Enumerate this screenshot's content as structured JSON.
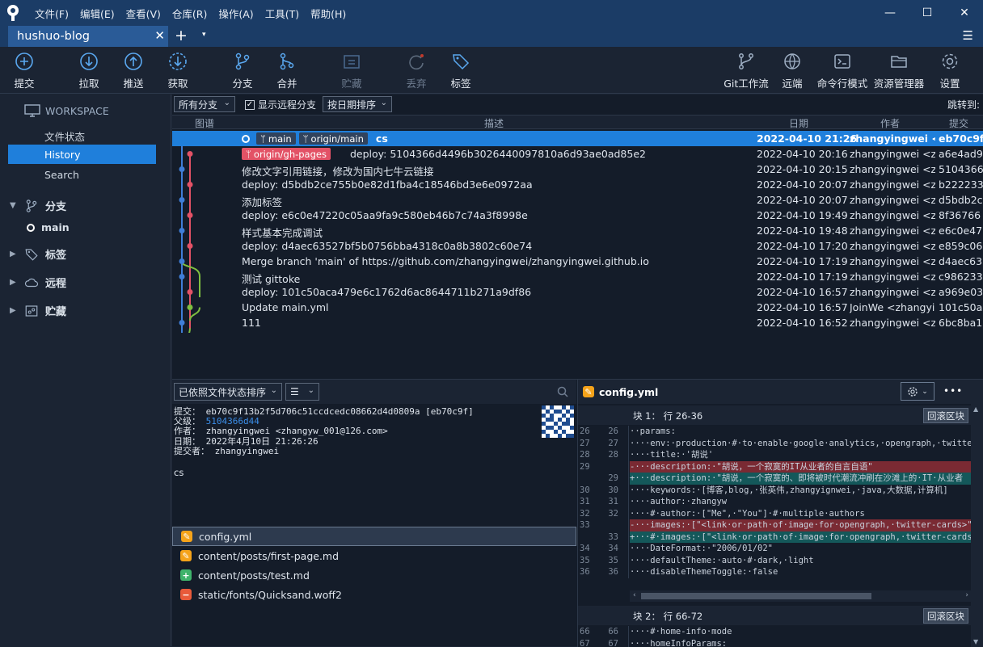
{
  "menu": {
    "items": [
      "文件(F)",
      "编辑(E)",
      "查看(V)",
      "仓库(R)",
      "操作(A)",
      "工具(T)",
      "帮助(H)"
    ]
  },
  "window": {
    "min": "—",
    "max": "☐",
    "close": "✕"
  },
  "tab": {
    "title": "hushuo-blog",
    "close": "✕",
    "add": "+",
    "dropdown": "▾",
    "menu": "☰"
  },
  "toolbar": {
    "commit": "提交",
    "pull": "拉取",
    "push": "推送",
    "fetch": "获取",
    "branch": "分支",
    "merge": "合并",
    "stash": "贮藏",
    "discard": "丢弃",
    "tag": "标签",
    "gitflow": "Git工作流",
    "remote": "远端",
    "terminal": "命令行模式",
    "explorer": "资源管理器",
    "settings": "设置"
  },
  "sidebar": {
    "workspace": "WORKSPACE",
    "file_status": "文件状态",
    "history": "History",
    "search": "Search",
    "branches": "分支",
    "main_branch": "main",
    "tags": "标签",
    "remotes": "远程",
    "stashes": "贮藏"
  },
  "graph": {
    "filter_branches": "所有分支",
    "show_remote": "显示远程分支",
    "sort": "按日期排序",
    "jump": "跳转到:",
    "headers": {
      "graph": "图谱",
      "desc": "描述",
      "date": "日期",
      "author": "作者",
      "commit": "提交"
    },
    "rows": [
      {
        "tags": [
          "main",
          "origin/main"
        ],
        "desc": "cs",
        "date": "2022-04-10 21:26",
        "author": "zhangyingwei <",
        "hash": "eb70c9f"
      },
      {
        "tags": [
          "origin/gh-pages"
        ],
        "desc": "deploy: 5104366d4496b3026440097810a6d93ae0ad85e2",
        "date": "2022-04-10 20:16",
        "author": "zhangyingwei <z",
        "hash": "a6e4ad9"
      },
      {
        "desc": "修改文字引用链接，修改为国内七牛云链接",
        "date": "2022-04-10 20:15",
        "author": "zhangyingwei <z",
        "hash": "5104366"
      },
      {
        "desc": "deploy: d5bdb2ce755b0e82d1fba4c18546bd3e6e0972aa",
        "date": "2022-04-10 20:07",
        "author": "zhangyingwei <z",
        "hash": "b222233"
      },
      {
        "desc": "添加标签",
        "date": "2022-04-10 20:07",
        "author": "zhangyingwei <z",
        "hash": "d5bdb2c"
      },
      {
        "desc": "deploy: e6c0e47220c05aa9fa9c580eb46b7c74a3f8998e",
        "date": "2022-04-10 19:49",
        "author": "zhangyingwei <z",
        "hash": "8f36766"
      },
      {
        "desc": "样式基本完成调试",
        "date": "2022-04-10 19:48",
        "author": "zhangyingwei <z",
        "hash": "e6c0e47"
      },
      {
        "desc": "deploy: d4aec63527bf5b0756bba4318c0a8b3802c60e74",
        "date": "2022-04-10 17:20",
        "author": "zhangyingwei <z",
        "hash": "e859c06"
      },
      {
        "desc": "Merge branch 'main' of https://github.com/zhangyingwei/zhangyingwei.github.io",
        "date": "2022-04-10 17:19",
        "author": "zhangyingwei <z",
        "hash": "d4aec63"
      },
      {
        "desc": "测试 gittoke",
        "date": "2022-04-10 17:19",
        "author": "zhangyingwei <z",
        "hash": "c986233"
      },
      {
        "desc": "deploy: 101c50aca479e6c1762d6ac8644711b271a9df86",
        "date": "2022-04-10 16:57",
        "author": "zhangyingwei <z",
        "hash": "a969e03"
      },
      {
        "desc": "Update main.yml",
        "date": "2022-04-10 16:57",
        "author": "JoinWe <zhangyi",
        "hash": "101c50a"
      },
      {
        "desc": "111",
        "date": "2022-04-10 16:52",
        "author": "zhangyingwei <z",
        "hash": "6bc8ba1"
      }
    ]
  },
  "detail": {
    "sort_label": "已依照文件状态排序",
    "view_icon": "☰",
    "commit_label": "提交：",
    "commit_value": "eb70c9f13b2f5d706c51ccdcedc08662d4d0809a [eb70c9f]",
    "parent_label": "父级：",
    "parent_value": "5104366d44",
    "author_label": "作者：",
    "author_value": "zhangyingwei <zhangyw_001@126.com>",
    "date_label": "日期：",
    "date_value": "2022年4月10日 21:26:26",
    "committer_label": "提交者：",
    "committer_value": "zhangyingwei",
    "message": "cs",
    "files": [
      {
        "name": "config.yml",
        "status": "modified",
        "color": "#f5a31a",
        "sym": "✎"
      },
      {
        "name": "content/posts/first-page.md",
        "status": "modified",
        "color": "#f5a31a",
        "sym": "✎"
      },
      {
        "name": "content/posts/test.md",
        "status": "added",
        "color": "#3fb36b",
        "sym": "+"
      },
      {
        "name": "static/fonts/Quicksand.woff2",
        "status": "removed",
        "color": "#e85a3a",
        "sym": "−"
      }
    ]
  },
  "diff": {
    "file": "config.yml",
    "more": "•••",
    "hunk1_label": "块 1：  行 26-36",
    "revert": "回滚区块",
    "hunk2_label": "块 2：  行 66-72",
    "lines1": [
      {
        "o": "26",
        "n": "26",
        "type": "ctx",
        "t": "··params:"
      },
      {
        "o": "27",
        "n": "27",
        "type": "ctx",
        "t": "····env:·production·#·to·enable·google·analytics,·opengraph,·twitter"
      },
      {
        "o": "28",
        "n": "28",
        "type": "ctx",
        "t": "····title:·'胡说'"
      },
      {
        "o": "29",
        "n": "",
        "type": "del",
        "t": "-···description:·\"胡说，一个寂寞的IT从业者的自言自语\""
      },
      {
        "o": "",
        "n": "29",
        "type": "add",
        "t": "+···description:·\"胡说，一个寂寞的、即将被时代潮流冲刷在沙滩上的·IT·从业者"
      },
      {
        "o": "30",
        "n": "30",
        "type": "ctx",
        "t": "····keywords:·[博客,blog,·张英伟,zhangyignwei,·java,大数据,计算机]"
      },
      {
        "o": "31",
        "n": "31",
        "type": "ctx",
        "t": "····author:·zhangyw"
      },
      {
        "o": "32",
        "n": "32",
        "type": "ctx",
        "t": "····#·author:·[\"Me\",·\"You\"]·#·multiple·authors"
      },
      {
        "o": "33",
        "n": "",
        "type": "del",
        "t": "-···images:·[\"<link·or·path·of·image·for·opengraph,·twitter-cards>\"]"
      },
      {
        "o": "",
        "n": "33",
        "type": "add",
        "t": "+···#·images:·[\"<link·or·path·of·image·for·opengraph,·twitter-cards>\"]"
      },
      {
        "o": "34",
        "n": "34",
        "type": "ctx",
        "t": "····DateFormat:·\"2006/01/02\""
      },
      {
        "o": "35",
        "n": "35",
        "type": "ctx",
        "t": "····defaultTheme:·auto·#·dark,·light"
      },
      {
        "o": "36",
        "n": "36",
        "type": "ctx",
        "t": "····disableThemeToggle:·false"
      }
    ],
    "lines2": [
      {
        "o": "66",
        "n": "66",
        "type": "ctx",
        "t": "····#·home-info·mode"
      },
      {
        "o": "67",
        "n": "67",
        "type": "ctx",
        "t": "····homeInfoParams:"
      }
    ]
  }
}
